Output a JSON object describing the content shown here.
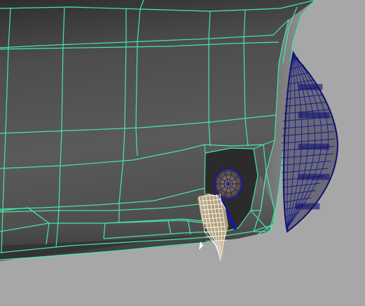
{
  "viewport": {
    "background_color": "#a7a7a7",
    "wireframe_color": "#46e6a6",
    "selected_wireframe_color": "#1a1a8c",
    "highlight_wireframe_color": "#ffffff",
    "body_shade_dark": "#3c3c3c",
    "body_shade_mid": "#5e5e5e",
    "body_shade_light": "#8c8c8c"
  },
  "objects": [
    {
      "name": "car-body-mesh",
      "display": "wireframe-on-shaded"
    },
    {
      "name": "headlight-mesh",
      "display": "selected-wireframe"
    },
    {
      "name": "fog-lamp-mesh",
      "display": "selected-wireframe"
    },
    {
      "name": "bulb-mesh",
      "display": "highlighted-wireframe"
    }
  ]
}
